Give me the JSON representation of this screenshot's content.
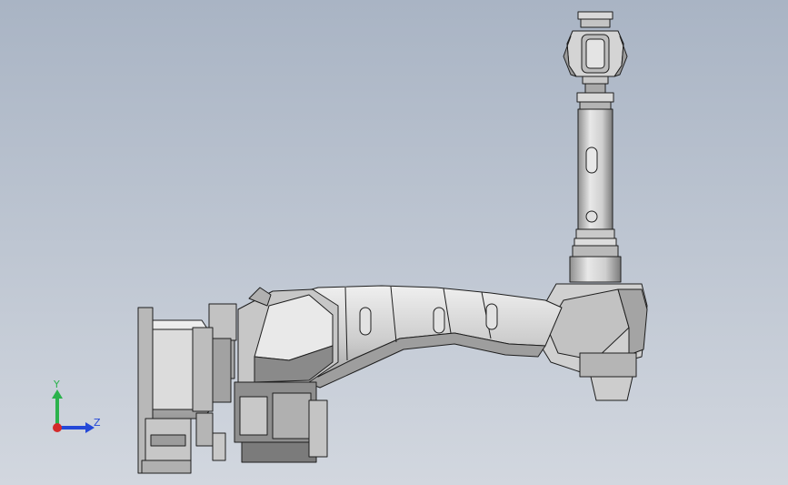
{
  "viewport": {
    "background_top": "#a9b4c4",
    "background_bottom": "#d2d7df"
  },
  "model": {
    "part_name": "robot-arm-assembly",
    "icon": "robot-arm-icon",
    "fill_light": "#e6e6e6",
    "fill_mid": "#c8c8c8",
    "fill_dark": "#8d8d8d",
    "edge_color": "#1e1e1e"
  },
  "triad": {
    "y_label": "Y",
    "z_label": "Z",
    "y_color": "#2bb24c",
    "z_color": "#2448d8",
    "x_color": "#d42a2a"
  }
}
